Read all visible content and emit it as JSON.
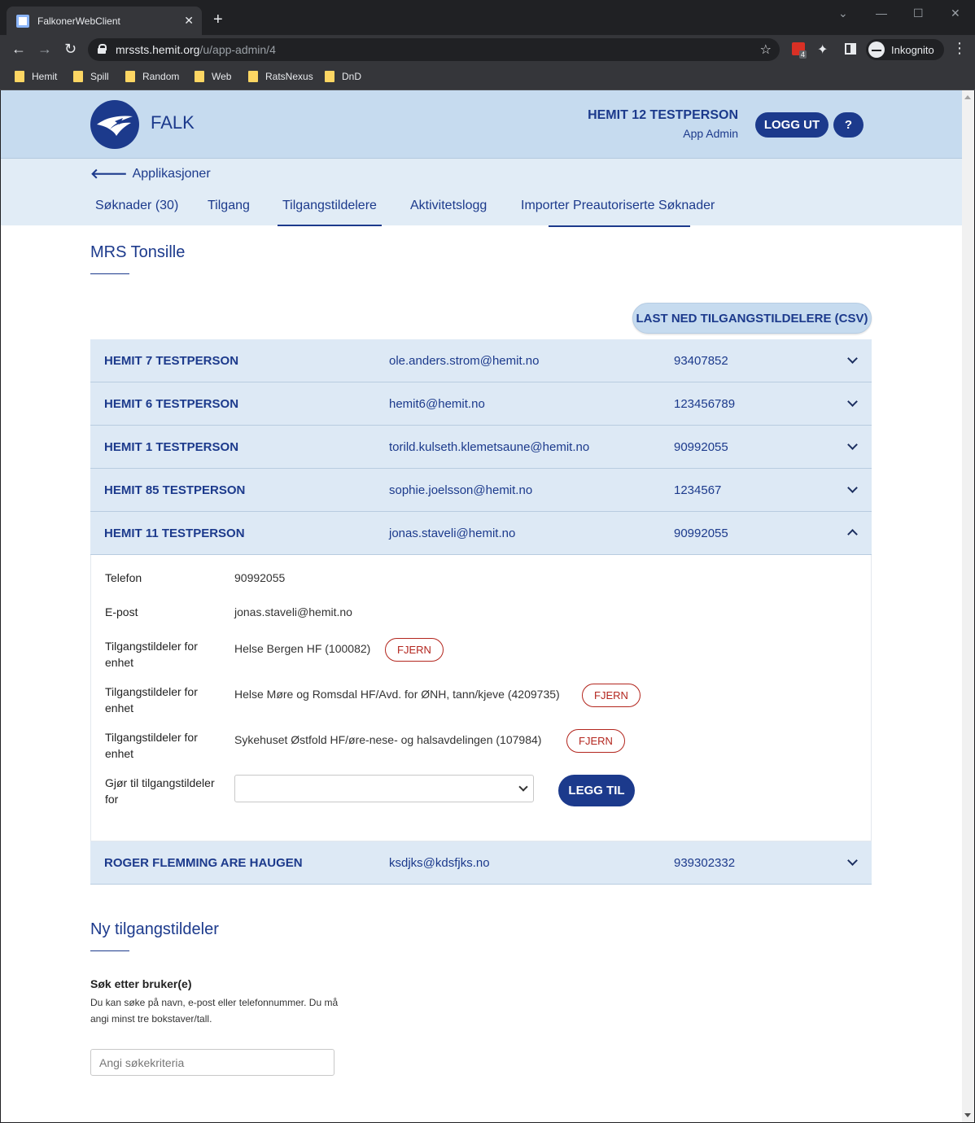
{
  "browser": {
    "tab_title": "FalkonerWebClient",
    "url_host": "mrssts.hemit.org",
    "url_path": "/u/app-admin/4",
    "profile_label": "Inkognito",
    "extension_badge": "4",
    "bookmarks": [
      "Hemit",
      "Spill",
      "Random",
      "Web",
      "RatsNexus",
      "DnD"
    ]
  },
  "header": {
    "app_name": "FALK",
    "user_name": "HEMIT 12 TESTPERSON",
    "user_role": "App Admin",
    "logout_label": "LOGG UT",
    "help_label": "?"
  },
  "subnav": {
    "back_label": "Applikasjoner",
    "tabs": [
      "Søknader (30)",
      "Tilgang",
      "Tilgangstildelere",
      "Aktivitetslogg",
      "Importer Preautoriserte Søknader"
    ],
    "active_tab": "Tilgangstildelere"
  },
  "main": {
    "title": "MRS Tonsille",
    "csv_button": "LAST NED TILGANGSTILDELERE (CSV)",
    "rows": [
      {
        "name": "HEMIT 7 TESTPERSON",
        "email": "ole.anders.strom@hemit.no",
        "phone": "93407852"
      },
      {
        "name": "HEMIT 6 TESTPERSON",
        "email": "hemit6@hemit.no",
        "phone": "123456789"
      },
      {
        "name": "HEMIT 1 TESTPERSON",
        "email": "torild.kulseth.klemetsaune@hemit.no",
        "phone": "90992055"
      },
      {
        "name": "HEMIT 85 TESTPERSON",
        "email": "sophie.joelsson@hemit.no",
        "phone": "1234567"
      },
      {
        "name": "HEMIT 11 TESTPERSON",
        "email": "jonas.staveli@hemit.no",
        "phone": "90992055"
      },
      {
        "name": "ROGER FLEMMING ARE HAUGEN",
        "email": "ksdjks@kdsfjks.no",
        "phone": "939302332"
      }
    ],
    "expanded": {
      "phone_label": "Telefon",
      "phone_value": "90992055",
      "email_label": "E-post",
      "email_value": "jonas.staveli@hemit.no",
      "units": [
        {
          "label": "Tilgangstildeler for enhet",
          "value": "Helse Bergen HF (100082)",
          "remove_label": "FJERN"
        },
        {
          "label": "Tilgangstildeler for enhet",
          "value": "Helse Møre og Romsdal HF/Avd. for ØNH, tann/kjeve (4209735)",
          "remove_label": "FJERN"
        },
        {
          "label": "Tilgangstildeler for enhet",
          "value": "Sykehuset Østfold HF/øre-nese- og halsavdelingen (107984)",
          "remove_label": "FJERN"
        }
      ],
      "add_label": "Gjør til tilgangstildeler for",
      "add_select_value": "",
      "add_button": "LEGG TIL"
    }
  },
  "new_section": {
    "title": "Ny tilgangstildeler",
    "search_label": "Søk etter bruker(e)",
    "search_help": "Du kan søke på navn, e-post eller telefonnummer. Du må angi minst tre bokstaver/tall.",
    "search_placeholder": "Angi søkekriteria"
  },
  "colors": {
    "brand": "#1c3a8c",
    "header_bg": "#c6dbef",
    "row_bg": "#dde9f5",
    "danger": "#b3261e"
  }
}
